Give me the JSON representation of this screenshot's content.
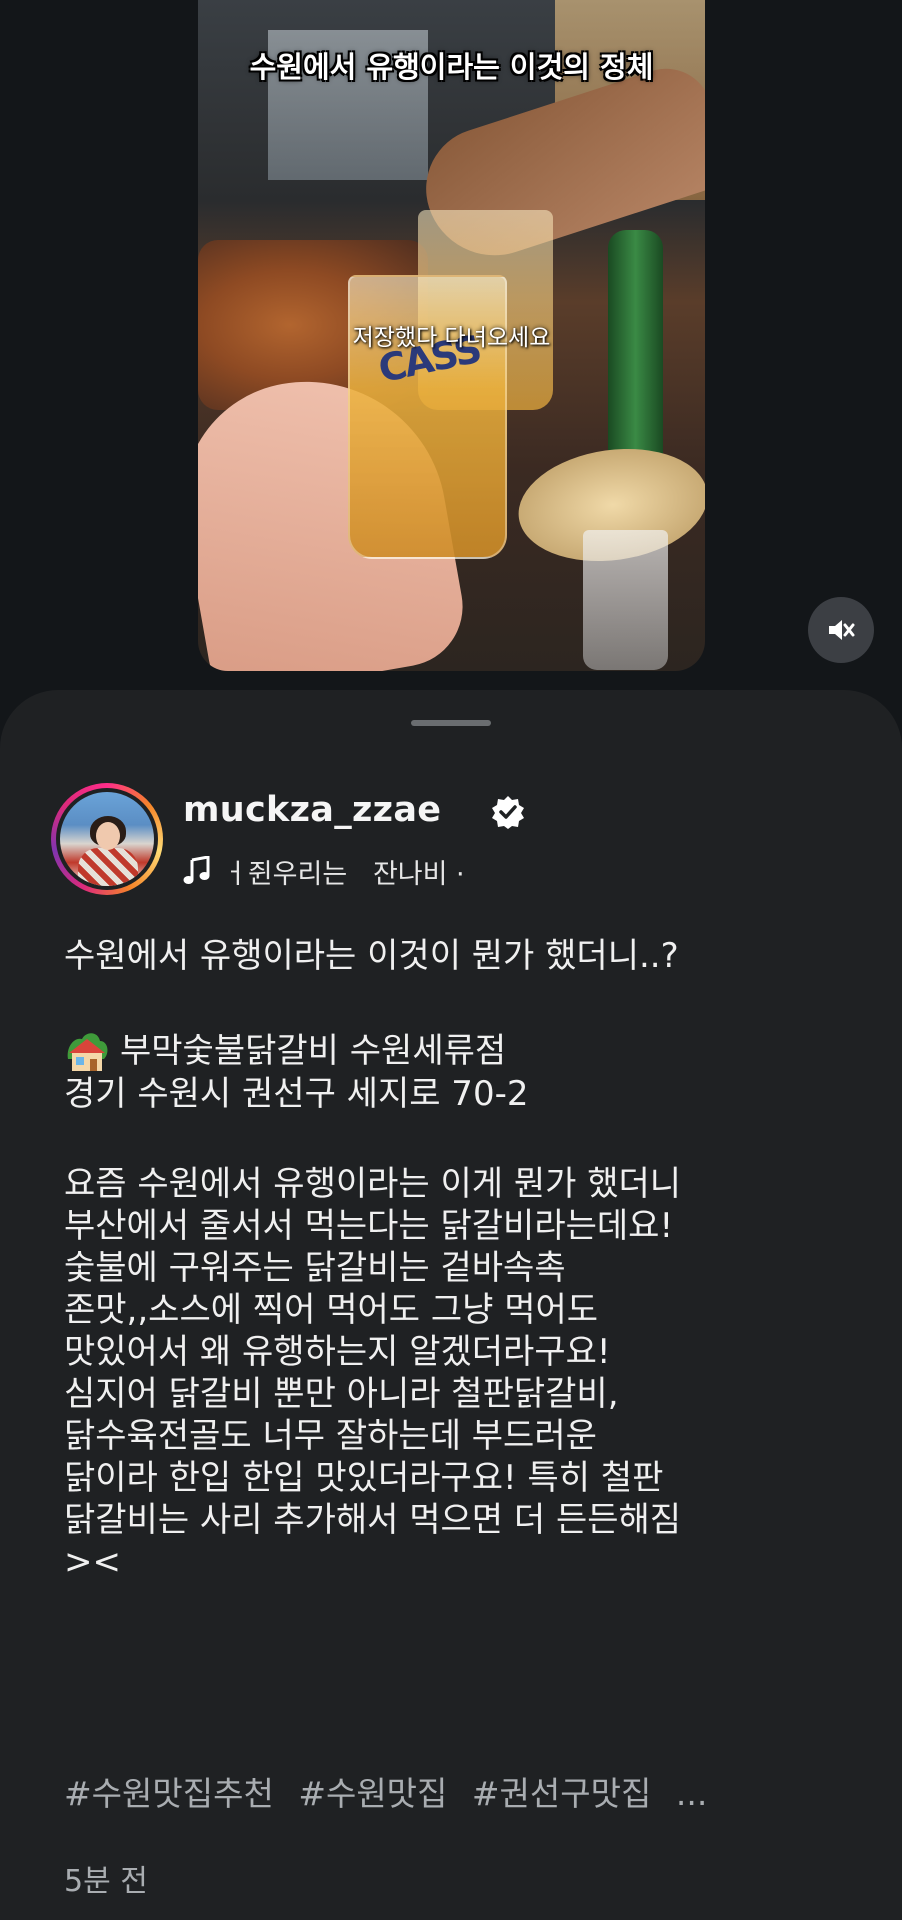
{
  "video": {
    "caption_top": "수원에서 유행이라는 이것의 정체",
    "caption_mid": "저장했다 다녀오세요",
    "glass_logo": "CASS",
    "mute_icon": "speaker-muted-icon"
  },
  "post": {
    "username": "muckza_zzae",
    "verified_icon": "verified-badge-icon",
    "music_icon": "music-note-icon",
    "music_text": "ㅓ쥔우리는   잔나비 ·",
    "lines": [
      "수원에서 유행이라는 이것이 뭔가 했더니..?"
    ],
    "restaurant_icon": "house-with-garden-emoji",
    "restaurant_name": "부막숯불닭갈비 수원세류점",
    "address": "경기 수원시 권선구 세지로 70-2",
    "description": [
      "요즘 수원에서 유행이라는 이게 뭔가 했더니",
      "부산에서 줄서서 먹는다는 닭갈비라는데요!",
      "숯불에 구워주는 닭갈비는 겉바속촉",
      "존맛,,소스에 찍어 먹어도 그냥 먹어도",
      "맛있어서 왜 유행하는지 알겠더라구요!",
      "심지어 닭갈비 뿐만 아니라 철판닭갈비,",
      "닭수육전골도 너무 잘하는데 부드러운",
      "닭이라 한입 한입 맛있더라구요! 특히 철판",
      "닭갈비는 사리 추가해서 먹으면 더 든든해짐",
      "><"
    ],
    "hashtags": [
      "#수원맛집추천",
      "#수원맛집",
      "#권선구맛집",
      "..."
    ],
    "time": "5분 전"
  }
}
